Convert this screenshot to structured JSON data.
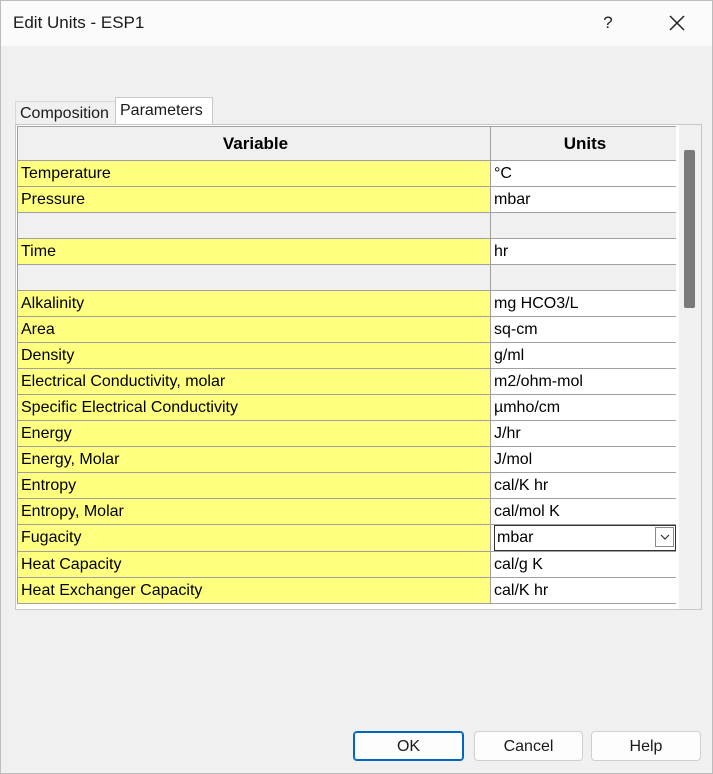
{
  "window": {
    "title": "Edit Units - ESP1",
    "help_label": "?"
  },
  "tabs": [
    {
      "label": "Composition",
      "active": false
    },
    {
      "label": "Parameters",
      "active": true
    }
  ],
  "grid": {
    "headers": {
      "variable": "Variable",
      "units": "Units"
    },
    "rows": [
      {
        "variable": "Temperature",
        "units": "°C"
      },
      {
        "variable": "Pressure",
        "units": "mbar"
      },
      {
        "separator": true
      },
      {
        "variable": "Time",
        "units": "hr"
      },
      {
        "separator": true
      },
      {
        "variable": "Alkalinity",
        "units": "mg HCO3/L"
      },
      {
        "variable": "Area",
        "units": "sq-cm"
      },
      {
        "variable": "Density",
        "units": "g/ml"
      },
      {
        "variable": "Electrical Conductivity, molar",
        "units": "m2/ohm-mol"
      },
      {
        "variable": "Specific Electrical Conductivity",
        "units": "µmho/cm"
      },
      {
        "variable": "Energy",
        "units": "J/hr"
      },
      {
        "variable": "Energy, Molar",
        "units": "J/mol"
      },
      {
        "variable": "Entropy",
        "units": "cal/K hr"
      },
      {
        "variable": "Entropy, Molar",
        "units": "cal/mol K"
      },
      {
        "variable": "Fugacity",
        "units": "mbar",
        "editing": true
      },
      {
        "variable": "Heat Capacity",
        "units": "cal/g K"
      },
      {
        "variable": "Heat Exchanger Capacity",
        "units": "cal/K hr"
      }
    ]
  },
  "buttons": {
    "ok": "OK",
    "cancel": "Cancel",
    "help": "Help"
  },
  "colors": {
    "variable_cell": "#ffff80",
    "separator_row": "#f0f0f0",
    "default_button_border": "#0067c0"
  }
}
